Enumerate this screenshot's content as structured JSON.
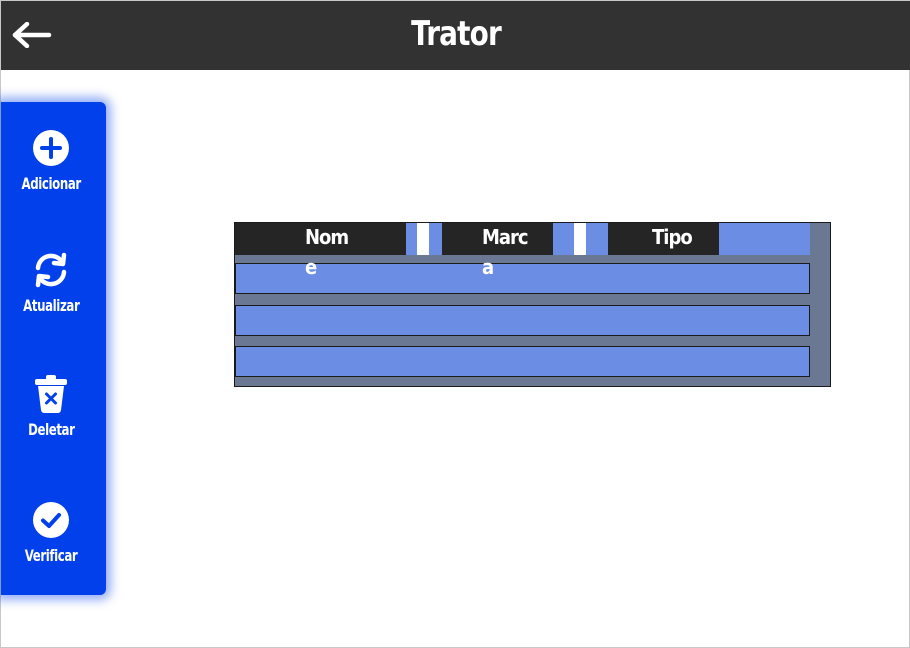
{
  "header": {
    "title": "Trator",
    "back_icon": "arrow-left-icon"
  },
  "sidebar": {
    "items": [
      {
        "label": "Adicionar",
        "icon": "plus-circle-icon"
      },
      {
        "label": "Atualizar",
        "icon": "refresh-icon"
      },
      {
        "label": "Deletar",
        "icon": "trash-icon"
      },
      {
        "label": "Verificar",
        "icon": "check-circle-icon"
      }
    ]
  },
  "table": {
    "columns": [
      {
        "label": "Nom",
        "overflow": "e"
      },
      {
        "label": "Marc",
        "overflow": "a"
      },
      {
        "label": "Tipo",
        "overflow": ""
      }
    ],
    "rows": [
      {
        "nome": "",
        "marca": "",
        "tipo": ""
      },
      {
        "nome": "",
        "marca": "",
        "tipo": ""
      },
      {
        "nome": "",
        "marca": "",
        "tipo": ""
      }
    ]
  },
  "colors": {
    "header_bg": "#323232",
    "sidebar_bg": "#0240ec",
    "row_bg": "#6b8de3",
    "grid_bg": "#6b7893",
    "column_header_bg": "#252525"
  }
}
